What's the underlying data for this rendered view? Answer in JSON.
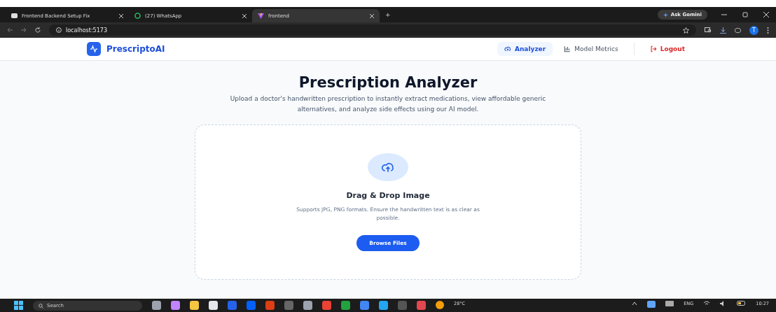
{
  "browser": {
    "tabs": [
      {
        "title": "Frontend Backend Setup Fix",
        "selected": false,
        "kind": "chat"
      },
      {
        "title": "(27) WhatsApp",
        "selected": false,
        "kind": "whatsapp"
      },
      {
        "title": "frontend",
        "selected": true,
        "kind": "vite"
      }
    ],
    "new_tab": "+",
    "ask_button": "Ask Gemini",
    "address": "localhost:5173",
    "profile": "T"
  },
  "app": {
    "brand": "PrescriptoAI",
    "nav": [
      {
        "label": "Analyzer",
        "selected": true,
        "kind": "analyzer"
      },
      {
        "label": "Model Metrics",
        "selected": false,
        "kind": "metrics"
      },
      {
        "label": "Logout",
        "selected": false,
        "kind": "logout"
      }
    ],
    "title": "Prescription Analyzer",
    "subtitle": "Upload a doctor's handwritten prescription to instantly extract medications, view affordable generic alternatives, and analyze side effects using our AI model.",
    "upload": {
      "heading": "Drag & Drop Image",
      "hint": "Supports JPG, PNG formats. Ensure the handwritten text is as clear as possible.",
      "button": "Browse Files"
    }
  },
  "taskbar": {
    "search_placeholder": "Search",
    "weather": "28°C",
    "language": "ENG",
    "time": "10:27"
  }
}
